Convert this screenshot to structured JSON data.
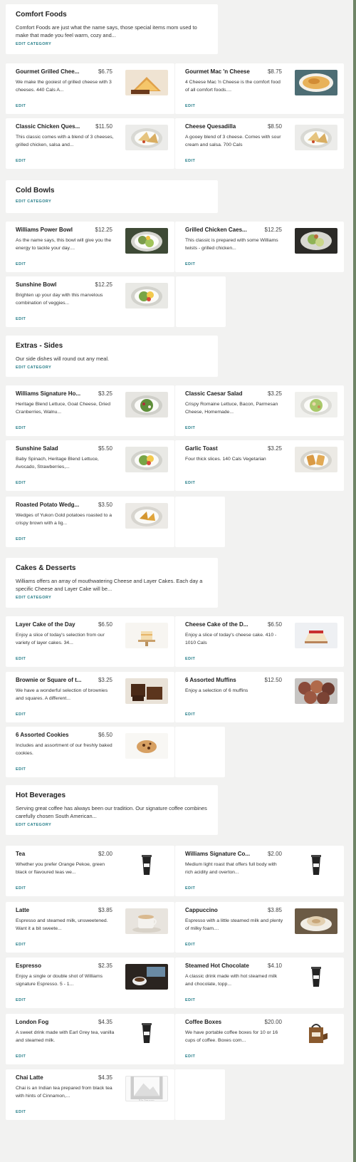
{
  "categories": [
    {
      "name": "Comfort Foods",
      "description": "Comfort Foods are just what the name says, those special items mom used to make that made you feel warm, cozy and...",
      "edit_label": "EDIT CATEGORY",
      "items": [
        {
          "name": "Gourmet Grilled Chee...",
          "price": "$6.75",
          "description": "We make the gooiest of grilled cheese with 3 cheeses. 440 Cals A...",
          "edit_label": "EDIT",
          "image": "grilled-cheese"
        },
        {
          "name": "Gourmet Mac 'n Cheese",
          "price": "$8.75",
          "description": "4 Cheese Mac 'n Cheese is the comfort food of all comfort foods....",
          "edit_label": "EDIT",
          "image": "mac-cheese"
        },
        {
          "name": "Classic Chicken Ques...",
          "price": "$11.50",
          "description": "This classic comes with a blend of 3 cheeses, grilled chicken, salsa and...",
          "edit_label": "EDIT",
          "image": "quesadilla"
        },
        {
          "name": "Cheese Quesadilla",
          "price": "$8.50",
          "description": "A gooey blend of 3 cheese. Comes with sour cream and salsa. 700 Cals",
          "edit_label": "EDIT",
          "image": "quesadilla"
        }
      ]
    },
    {
      "name": "Cold Bowls",
      "description": "",
      "edit_label": "EDIT CATEGORY",
      "items": [
        {
          "name": "Williams Power Bowl",
          "price": "$12.25",
          "description": "As the name says, this bowl will give you the energy to tackle your day....",
          "edit_label": "EDIT",
          "image": "power-bowl"
        },
        {
          "name": "Grilled Chicken Caes...",
          "price": "$12.25",
          "description": "This classic is prepared with some Williams twists - grilled chicken...",
          "edit_label": "EDIT",
          "image": "caesar-dark"
        },
        {
          "name": "Sunshine Bowl",
          "price": "$12.25",
          "description": "Brighten up your day with this marvelous combination of veggies...",
          "edit_label": "EDIT",
          "image": "sunshine-bowl"
        }
      ]
    },
    {
      "name": "Extras - Sides",
      "description": "Our side dishes will round out any meal.",
      "edit_label": "EDIT CATEGORY",
      "items": [
        {
          "name": "Williams Signature Ho...",
          "price": "$3.25",
          "description": "Heritage Blend Lettuce, Goat Cheese, Dried Cranberries, Walnu...",
          "edit_label": "EDIT",
          "image": "green-salad"
        },
        {
          "name": "Classic Caesar Salad",
          "price": "$3.25",
          "description": "Crispy Romaine Lettuce, Bacon, Parmesan Cheese, Homemade...",
          "edit_label": "EDIT",
          "image": "caesar-light"
        },
        {
          "name": "Sunshine Salad",
          "price": "$5.50",
          "description": "Baby Spinach, Heritage Blend Lettuce, Avocado, Strawberries,...",
          "edit_label": "EDIT",
          "image": "sunshine-bowl"
        },
        {
          "name": "Garlic Toast",
          "price": "$3.25",
          "description": "Four thick slices. 140 Cals Vegetarian",
          "edit_label": "EDIT",
          "image": "garlic-toast"
        },
        {
          "name": "Roasted Potato Wedg...",
          "price": "$3.50",
          "description": "Wedges of Yukon Gold potatoes roasted to a crispy brown with a lig...",
          "edit_label": "EDIT",
          "image": "potato-wedges"
        }
      ]
    },
    {
      "name": "Cakes & Desserts",
      "description": "Williams offers an array of mouthwatering Cheese and Layer Cakes. Each day a specific Cheese and Layer Cake will be...",
      "edit_label": "EDIT CATEGORY",
      "items": [
        {
          "name": "Layer Cake of the Day",
          "price": "$6.50",
          "description": "Enjoy a slice of today's selection from our variety of layer cakes. 34...",
          "edit_label": "EDIT",
          "image": "layer-cake"
        },
        {
          "name": "Cheese Cake of the D...",
          "price": "$6.50",
          "description": "Enjoy a slice of today's cheese cake. 410 - 1010 Cals",
          "edit_label": "EDIT",
          "image": "cheese-cake"
        },
        {
          "name": "Brownie or Square of t...",
          "price": "$3.25",
          "description": "We have a wonderful selection of brownies and squares. A different...",
          "edit_label": "EDIT",
          "image": "brownie"
        },
        {
          "name": "6 Assorted Muffins",
          "price": "$12.50",
          "description": "Enjoy a selection of 6 muffins",
          "edit_label": "EDIT",
          "image": "muffins"
        },
        {
          "name": "6 Assorted Cookies",
          "price": "$6.50",
          "description": "Includes and assortment of our freshly baked cookies.",
          "edit_label": "EDIT",
          "image": "cookie"
        }
      ]
    },
    {
      "name": "Hot Beverages",
      "description": "Serving great coffee has always been our tradition. Our signature coffee combines carefully chosen South American...",
      "edit_label": "EDIT CATEGORY",
      "items": [
        {
          "name": "Tea",
          "price": "$2.00",
          "description": "Whether you prefer Orange Pekoe, green black or flavoured teas we...",
          "edit_label": "EDIT",
          "image": "cup"
        },
        {
          "name": "Williams Signature Co...",
          "price": "$2.00",
          "description": "Medium light roast that offers full body with rich acidity and overton...",
          "edit_label": "EDIT",
          "image": "cup"
        },
        {
          "name": "Latte",
          "price": "$3.85",
          "description": "Espresso and steamed milk, unsweetened. Want it a bit sweete...",
          "edit_label": "EDIT",
          "image": "latte"
        },
        {
          "name": "Cappuccino",
          "price": "$3.85",
          "description": "Espresso with a little steamed milk and plenty of milky foam....",
          "edit_label": "EDIT",
          "image": "cappuccino"
        },
        {
          "name": "Espresso",
          "price": "$2.35",
          "description": "Enjoy a single or double shot of Williams signature Espresso. 5 - 1...",
          "edit_label": "EDIT",
          "image": "espresso"
        },
        {
          "name": "Steamed Hot Chocolate",
          "price": "$4.10",
          "description": "A classic drink made with hot steamed milk and chocolate, topp...",
          "edit_label": "EDIT",
          "image": "cup"
        },
        {
          "name": "London Fog",
          "price": "$4.35",
          "description": "A sweet drink made with Earl Grey tea, vanilla and steamed milk.",
          "edit_label": "EDIT",
          "image": "cup"
        },
        {
          "name": "Coffee Boxes",
          "price": "$20.00",
          "description": "We have portable coffee boxes for 10 or 16 cups of coffee. Boxes com...",
          "edit_label": "EDIT",
          "image": "coffee-box"
        },
        {
          "name": "Chai Latte",
          "price": "$4.35",
          "description": "Chai is an Indian tea prepared from black tea with hints of Cinnamon,...",
          "edit_label": "EDIT",
          "image": "no-image",
          "no_image_label": "No Image"
        }
      ]
    }
  ]
}
